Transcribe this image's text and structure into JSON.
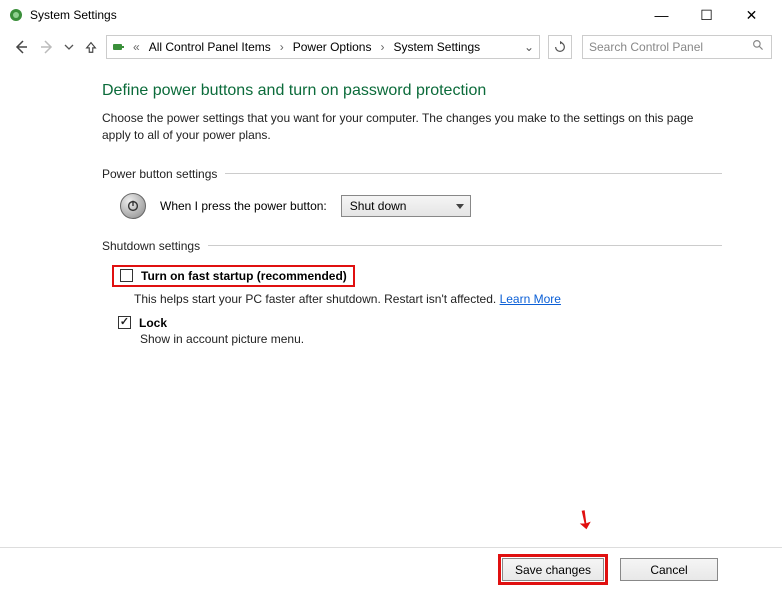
{
  "window": {
    "title": "System Settings"
  },
  "breadcrumb": {
    "prefix": "«",
    "items": [
      "All Control Panel Items",
      "Power Options",
      "System Settings"
    ]
  },
  "search": {
    "placeholder": "Search Control Panel"
  },
  "page": {
    "title": "Define power buttons and turn on password protection",
    "description": "Choose the power settings that you want for your computer. The changes you make to the settings on this page apply to all of your power plans."
  },
  "sections": {
    "power_button": {
      "header": "Power button settings",
      "press_label": "When I press the power button:",
      "selected_action": "Shut down"
    },
    "shutdown": {
      "header": "Shutdown settings",
      "fast_startup": {
        "title": "Turn on fast startup (recommended)",
        "desc": "This helps start your PC faster after shutdown. Restart isn't affected. ",
        "learn_more": "Learn More",
        "checked": false
      },
      "lock": {
        "title": "Lock",
        "desc": "Show in account picture menu.",
        "checked": true
      }
    }
  },
  "footer": {
    "save": "Save changes",
    "cancel": "Cancel"
  }
}
